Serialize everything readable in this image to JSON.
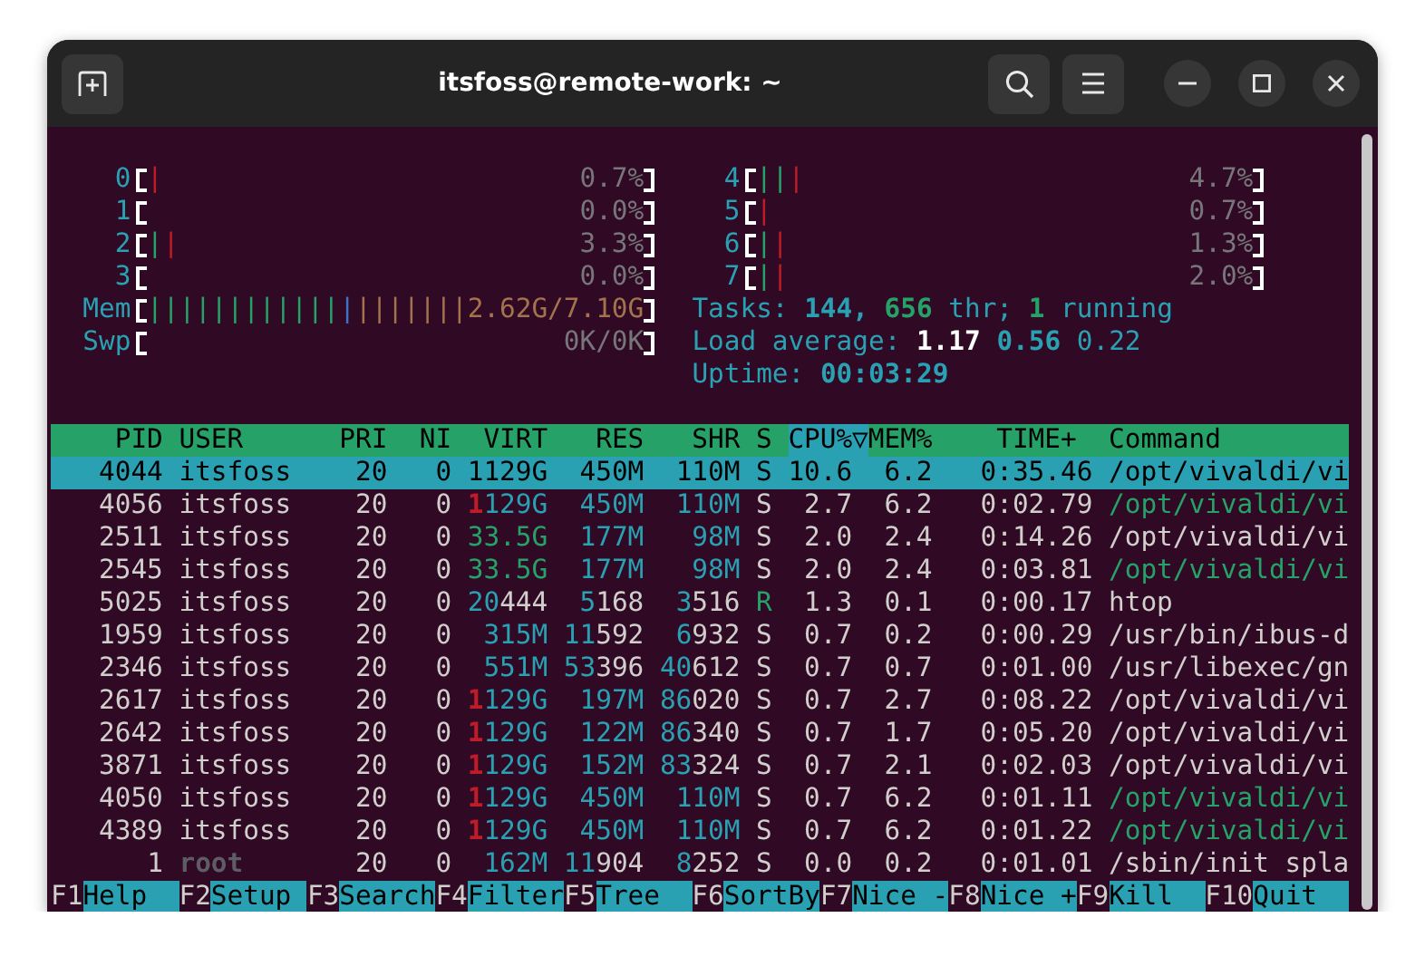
{
  "window": {
    "title": "itsfoss@remote-work: ~"
  },
  "left_column": {
    "meters": [
      {
        "kind": "cpu",
        "label": "0",
        "value": "0.7%",
        "segments": [
          {
            "kind": "kernel",
            "bars": "|"
          }
        ]
      },
      {
        "kind": "cpu",
        "label": "1",
        "value": "0.0%"
      },
      {
        "kind": "cpu",
        "label": "2",
        "value": "3.3%",
        "segments": [
          {
            "kind": "normal",
            "bars": "|"
          },
          {
            "kind": "kernel",
            "bars": "|"
          }
        ]
      },
      {
        "kind": "cpu",
        "label": "3",
        "value": "0.0%"
      },
      {
        "kind": "memory",
        "label": "Mem",
        "value": "2.62G/7.10G",
        "segments": [
          {
            "kind": "used",
            "bars": "||||||||||||"
          },
          {
            "kind": "buffers",
            "bars": "|"
          },
          {
            "kind": "cache",
            "bars": "|||||||"
          }
        ]
      },
      {
        "kind": "swap",
        "label": "Swp",
        "value": "0K/0K"
      }
    ]
  },
  "right_column": {
    "meters": [
      {
        "kind": "cpu",
        "label": "4",
        "value": "4.7%",
        "segments": [
          {
            "kind": "normal",
            "bars": "||"
          },
          {
            "kind": "kernel",
            "bars": "|"
          }
        ]
      },
      {
        "kind": "cpu",
        "label": "5",
        "value": "0.7%",
        "segments": [
          {
            "kind": "kernel",
            "bars": "|"
          }
        ]
      },
      {
        "kind": "cpu",
        "label": "6",
        "value": "1.3%",
        "segments": [
          {
            "kind": "normal",
            "bars": "|"
          },
          {
            "kind": "kernel",
            "bars": "|"
          }
        ]
      },
      {
        "kind": "cpu",
        "label": "7",
        "value": "2.0%",
        "segments": [
          {
            "kind": "normal",
            "bars": "|"
          },
          {
            "kind": "kernel",
            "bars": "|"
          }
        ]
      }
    ],
    "summary": [
      {
        "segments": [
          {
            "kind": "label",
            "text": "Tasks:"
          },
          {
            "kind": "total",
            "text": "144,"
          },
          {
            "kind": "threads",
            "text": "656"
          },
          {
            "kind": "label",
            "text": "thr;"
          },
          {
            "kind": "running",
            "text": "1"
          },
          {
            "kind": "label",
            "text": "running"
          }
        ]
      },
      {
        "segments": [
          {
            "kind": "label",
            "text": "Load average:"
          },
          {
            "kind": "load_1",
            "text": "1.17"
          },
          {
            "kind": "load_5",
            "text": "0.56"
          },
          {
            "kind": "load_15",
            "text": "0.22"
          }
        ]
      },
      {
        "segments": [
          {
            "kind": "label",
            "text": "Uptime:"
          },
          {
            "kind": "uptime",
            "text": "00:03:29"
          }
        ]
      }
    ]
  },
  "columns": [
    {
      "label": "PID",
      "sorted": false
    },
    {
      "label": "USER",
      "sorted": false
    },
    {
      "label": "PRI",
      "sorted": false
    },
    {
      "label": "NI",
      "sorted": false
    },
    {
      "label": "VIRT",
      "sorted": false
    },
    {
      "label": "RES",
      "sorted": false
    },
    {
      "label": "SHR",
      "sorted": false
    },
    {
      "label": "S",
      "sorted": false
    },
    {
      "label": "CPU%",
      "sorted": true,
      "sort_indicator": "▽"
    },
    {
      "label": "MEM%",
      "sorted": false
    },
    {
      "label": "TIME+",
      "sorted": false
    },
    {
      "label": "Command",
      "sorted": false
    }
  ],
  "processes": [
    {
      "pid": "4044",
      "user": "itsfoss",
      "pri": "20",
      "ni": "0",
      "virt": "1129G",
      "res": "450M",
      "shr": "110M",
      "state": "S",
      "cpu": "10.6",
      "mem": "6.2",
      "time": "0:35.46",
      "command": "/opt/vivaldi/vi",
      "selected": true,
      "thread": false,
      "running": false,
      "other_user": false
    },
    {
      "pid": "4056",
      "user": "itsfoss",
      "pri": "20",
      "ni": "0",
      "virt": "1129G",
      "res": "450M",
      "shr": "110M",
      "state": "S",
      "cpu": "2.7",
      "mem": "6.2",
      "time": "0:02.79",
      "command": "/opt/vivaldi/vi",
      "selected": false,
      "thread": true,
      "running": false,
      "other_user": false
    },
    {
      "pid": "2511",
      "user": "itsfoss",
      "pri": "20",
      "ni": "0",
      "virt": "33.5G",
      "res": "177M",
      "shr": "98M",
      "state": "S",
      "cpu": "2.0",
      "mem": "2.4",
      "time": "0:14.26",
      "command": "/opt/vivaldi/vi",
      "selected": false,
      "thread": false,
      "running": false,
      "other_user": false
    },
    {
      "pid": "2545",
      "user": "itsfoss",
      "pri": "20",
      "ni": "0",
      "virt": "33.5G",
      "res": "177M",
      "shr": "98M",
      "state": "S",
      "cpu": "2.0",
      "mem": "2.4",
      "time": "0:03.81",
      "command": "/opt/vivaldi/vi",
      "selected": false,
      "thread": true,
      "running": false,
      "other_user": false
    },
    {
      "pid": "5025",
      "user": "itsfoss",
      "pri": "20",
      "ni": "0",
      "virt": "20444",
      "res": "5168",
      "shr": "3516",
      "state": "R",
      "cpu": "1.3",
      "mem": "0.1",
      "time": "0:00.17",
      "command": "htop",
      "selected": false,
      "thread": false,
      "running": true,
      "other_user": false
    },
    {
      "pid": "1959",
      "user": "itsfoss",
      "pri": "20",
      "ni": "0",
      "virt": "315M",
      "res": "11592",
      "shr": "6932",
      "state": "S",
      "cpu": "0.7",
      "mem": "0.2",
      "time": "0:00.29",
      "command": "/usr/bin/ibus-d",
      "selected": false,
      "thread": false,
      "running": false,
      "other_user": false
    },
    {
      "pid": "2346",
      "user": "itsfoss",
      "pri": "20",
      "ni": "0",
      "virt": "551M",
      "res": "53396",
      "shr": "40612",
      "state": "S",
      "cpu": "0.7",
      "mem": "0.7",
      "time": "0:01.00",
      "command": "/usr/libexec/gn",
      "selected": false,
      "thread": false,
      "running": false,
      "other_user": false
    },
    {
      "pid": "2617",
      "user": "itsfoss",
      "pri": "20",
      "ni": "0",
      "virt": "1129G",
      "res": "197M",
      "shr": "86020",
      "state": "S",
      "cpu": "0.7",
      "mem": "2.7",
      "time": "0:08.22",
      "command": "/opt/vivaldi/vi",
      "selected": false,
      "thread": false,
      "running": false,
      "other_user": false
    },
    {
      "pid": "2642",
      "user": "itsfoss",
      "pri": "20",
      "ni": "0",
      "virt": "1129G",
      "res": "122M",
      "shr": "86340",
      "state": "S",
      "cpu": "0.7",
      "mem": "1.7",
      "time": "0:05.20",
      "command": "/opt/vivaldi/vi",
      "selected": false,
      "thread": false,
      "running": false,
      "other_user": false
    },
    {
      "pid": "3871",
      "user": "itsfoss",
      "pri": "20",
      "ni": "0",
      "virt": "1129G",
      "res": "152M",
      "shr": "83324",
      "state": "S",
      "cpu": "0.7",
      "mem": "2.1",
      "time": "0:02.03",
      "command": "/opt/vivaldi/vi",
      "selected": false,
      "thread": false,
      "running": false,
      "other_user": false
    },
    {
      "pid": "4050",
      "user": "itsfoss",
      "pri": "20",
      "ni": "0",
      "virt": "1129G",
      "res": "450M",
      "shr": "110M",
      "state": "S",
      "cpu": "0.7",
      "mem": "6.2",
      "time": "0:01.11",
      "command": "/opt/vivaldi/vi",
      "selected": false,
      "thread": true,
      "running": false,
      "other_user": false
    },
    {
      "pid": "4389",
      "user": "itsfoss",
      "pri": "20",
      "ni": "0",
      "virt": "1129G",
      "res": "450M",
      "shr": "110M",
      "state": "S",
      "cpu": "0.7",
      "mem": "6.2",
      "time": "0:01.22",
      "command": "/opt/vivaldi/vi",
      "selected": false,
      "thread": true,
      "running": false,
      "other_user": false
    },
    {
      "pid": "1",
      "user": "root",
      "pri": "20",
      "ni": "0",
      "virt": "162M",
      "res": "11904",
      "shr": "8252",
      "state": "S",
      "cpu": "0.0",
      "mem": "0.2",
      "time": "0:01.01",
      "command": "/sbin/init spla",
      "selected": false,
      "thread": false,
      "running": false,
      "other_user": true
    }
  ],
  "function_keys": [
    {
      "key": "F1",
      "label": "Help"
    },
    {
      "key": "F2",
      "label": "Setup"
    },
    {
      "key": "F3",
      "label": "Search"
    },
    {
      "key": "F4",
      "label": "Filter"
    },
    {
      "key": "F5",
      "label": "Tree"
    },
    {
      "key": "F6",
      "label": "SortBy"
    },
    {
      "key": "F7",
      "label": "Nice -"
    },
    {
      "key": "F8",
      "label": "Nice +"
    },
    {
      "key": "F9",
      "label": "Kill"
    },
    {
      "key": "F10",
      "label": "Quit"
    }
  ]
}
